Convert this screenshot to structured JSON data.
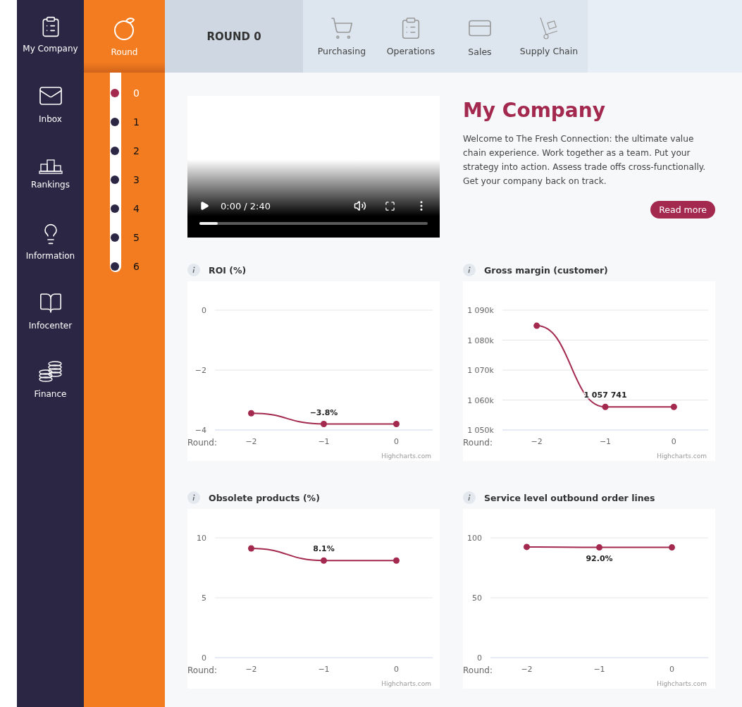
{
  "sidebar": {
    "items": [
      {
        "label": "My Company"
      },
      {
        "label": "Inbox"
      },
      {
        "label": "Rankings"
      },
      {
        "label": "Information"
      },
      {
        "label": "Infocenter"
      },
      {
        "label": "Finance"
      }
    ]
  },
  "round_menu": {
    "label": "Round",
    "rounds": [
      {
        "label": "0",
        "selected": true
      },
      {
        "label": "1",
        "selected": false
      },
      {
        "label": "2",
        "selected": false
      },
      {
        "label": "3",
        "selected": false
      },
      {
        "label": "4",
        "selected": false
      },
      {
        "label": "5",
        "selected": false
      },
      {
        "label": "6",
        "selected": false
      }
    ]
  },
  "top_bar": {
    "heading": "ROUND 0",
    "tabs": [
      {
        "label": "Purchasing"
      },
      {
        "label": "Operations"
      },
      {
        "label": "Sales"
      },
      {
        "label": "Supply Chain"
      }
    ]
  },
  "intro": {
    "video": {
      "time": "0:00 / 2:40",
      "level": 0.08
    },
    "title": "My Company",
    "text": "Welcome to The Fresh Connection: the ultimate value chain experience. Work together as a team. Put your strategy into action. Assess trade offs cross-functionally. Get your company back on track.",
    "button": "Read more"
  },
  "charts": [
    {
      "title": "ROI (%)",
      "credits": "Highcharts.com",
      "chart_data": {
        "type": "line",
        "grid": true,
        "xlim": [
          -2.5,
          0.5
        ],
        "xlabel": "Round:",
        "x": [
          -2,
          -1,
          0
        ],
        "xticks": [
          {
            "value": -2,
            "label": "−2"
          },
          {
            "value": -1,
            "label": "−1"
          },
          {
            "value": 0,
            "label": "0"
          }
        ],
        "ylim": [
          -4,
          0
        ],
        "yticks": [
          {
            "value": 0,
            "label": "0"
          },
          {
            "value": -2,
            "label": "−2"
          },
          {
            "value": -4,
            "label": "−4"
          }
        ],
        "series": [
          {
            "color": "#a3294f",
            "marker": true,
            "values": [
              -3.44,
              -3.8,
              -3.8
            ]
          }
        ],
        "value_labels": [
          null,
          "−3.8%",
          null
        ]
      }
    },
    {
      "title": "Gross margin (customer)",
      "credits": "Highcharts.com",
      "chart_data": {
        "type": "line",
        "grid": true,
        "xlim": [
          -2.5,
          0.5
        ],
        "xlabel": "Round:",
        "x": [
          -2,
          -1,
          0
        ],
        "xticks": [
          {
            "value": -2,
            "label": "−2"
          },
          {
            "value": -1,
            "label": "−1"
          },
          {
            "value": 0,
            "label": "0"
          }
        ],
        "ylim": [
          1050,
          1090
        ],
        "yticks": [
          {
            "value": 1090,
            "label": "1 090k"
          },
          {
            "value": 1080,
            "label": "1 080k"
          },
          {
            "value": 1070,
            "label": "1 070k"
          },
          {
            "value": 1060,
            "label": "1 060k"
          },
          {
            "value": 1050,
            "label": "1 050k"
          }
        ],
        "series": [
          {
            "color": "#a3294f",
            "marker": true,
            "values": [
              1084.8,
              1057.7,
              1057.7
            ]
          }
        ],
        "value_labels": [
          null,
          "1 057 741",
          null
        ]
      }
    },
    {
      "title": "Obsolete products (%)",
      "credits": "Highcharts.com",
      "chart_data": {
        "type": "line",
        "grid": true,
        "xlim": [
          -2.5,
          0.5
        ],
        "xlabel": "Round:",
        "x": [
          -2,
          -1,
          0
        ],
        "xticks": [
          {
            "value": -2,
            "label": "−2"
          },
          {
            "value": -1,
            "label": "−1"
          },
          {
            "value": 0,
            "label": "0"
          }
        ],
        "ylim": [
          0,
          10
        ],
        "yticks": [
          {
            "value": 10,
            "label": "10"
          },
          {
            "value": 5,
            "label": "5"
          },
          {
            "value": 0,
            "label": "0"
          }
        ],
        "series": [
          {
            "color": "#a3294f",
            "marker": true,
            "values": [
              9.12,
              8.1,
              8.1
            ]
          }
        ],
        "value_labels": [
          null,
          "8.1%",
          null
        ]
      }
    },
    {
      "title": "Service level outbound order lines",
      "credits": "Highcharts.com",
      "chart_data": {
        "type": "line",
        "grid": true,
        "xlim": [
          -2.5,
          0.5
        ],
        "xlabel": "Round:",
        "x": [
          -2,
          -1,
          0
        ],
        "xticks": [
          {
            "value": -2,
            "label": "−2"
          },
          {
            "value": -1,
            "label": "−1"
          },
          {
            "value": 0,
            "label": "0"
          }
        ],
        "ylim": [
          0,
          100
        ],
        "yticks": [
          {
            "value": 100,
            "label": "100"
          },
          {
            "value": 50,
            "label": "50"
          },
          {
            "value": 0,
            "label": "0"
          }
        ],
        "series": [
          {
            "color": "#a3294f",
            "marker": true,
            "values": [
              92.4,
              92.0,
              92.0
            ]
          }
        ],
        "value_labels": [
          null,
          "92.0%",
          null
        ]
      }
    }
  ]
}
